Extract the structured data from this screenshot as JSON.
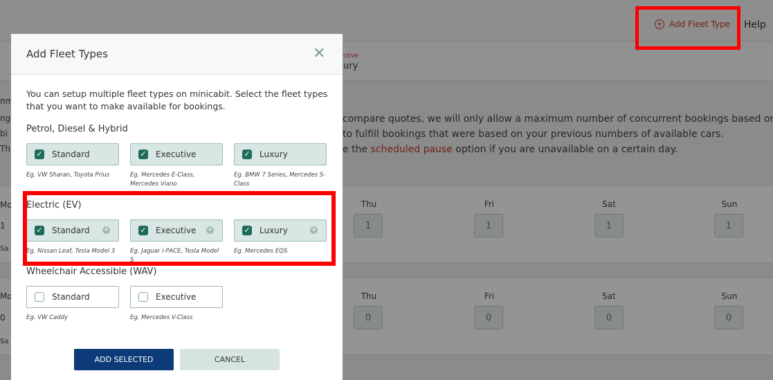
{
  "header": {
    "add_fleet_type": "Add Fleet Type",
    "help": "Help",
    "add_icon": "plus-circle-icon"
  },
  "background": {
    "tab_small": "ctive",
    "tab_big": "ury",
    "info_line1": "compare quotes, we will only allow a maximum number of concurrent bookings based on",
    "info_line2": "to fulfill bookings that were based on your previous numbers of available cars.",
    "info_line3_pre": "e the ",
    "info_line3_link": "scheduled pause",
    "info_line3_post": " option if you are unavailable on a certain day.",
    "left_fragments": [
      "nm",
      "ng",
      "bi",
      "Th",
      "Mo",
      "1",
      "Sa",
      "Mo",
      "0",
      "Sa"
    ],
    "days": [
      "Thu",
      "Fri",
      "Sat",
      "Sun"
    ],
    "row1_values": [
      "1",
      "1",
      "1",
      "1"
    ],
    "row2_values": [
      "0",
      "0",
      "0",
      "0"
    ]
  },
  "modal": {
    "title": "Add Fleet Types",
    "close_icon": "close-icon",
    "description": "You can setup multiple fleet types on minicabit. Select the fleet types that you want to make available for bookings.",
    "sections": [
      {
        "title": "Petrol, Diesel & Hybrid",
        "options": [
          {
            "label": "Standard",
            "checked": true,
            "example": "Eg. VW Sharan, Toyota Prius"
          },
          {
            "label": "Executive",
            "checked": true,
            "example": "Eg. Mercedes E-Class, Mercedes Viano"
          },
          {
            "label": "Luxury",
            "checked": true,
            "example": "Eg. BMW 7 Series, Mercedes S-Class"
          }
        ]
      },
      {
        "title": "Electric (EV)",
        "options": [
          {
            "label": "Standard",
            "checked": true,
            "example": "Eg. Nissan Leaf, Tesla Model 3"
          },
          {
            "label": "Executive",
            "checked": true,
            "example": "Eg. Jaguar i-PACE, Tesla Model S"
          },
          {
            "label": "Luxury",
            "checked": true,
            "example": "Eg. Mercedes EQS"
          }
        ]
      },
      {
        "title": "Wheelchair Accessible (WAV)",
        "options": [
          {
            "label": "Standard",
            "checked": false,
            "example": "Eg. VW Caddy"
          },
          {
            "label": "Executive",
            "checked": false,
            "example": "Eg. Mercedes V-Class"
          }
        ]
      }
    ],
    "add_button": "ADD SELECTED",
    "cancel_button": "CANCEL"
  },
  "colors": {
    "primary": "#0d3b7a",
    "accent": "#c0392b",
    "checkbox": "#1e6b5a",
    "highlight": "#ff0000"
  }
}
